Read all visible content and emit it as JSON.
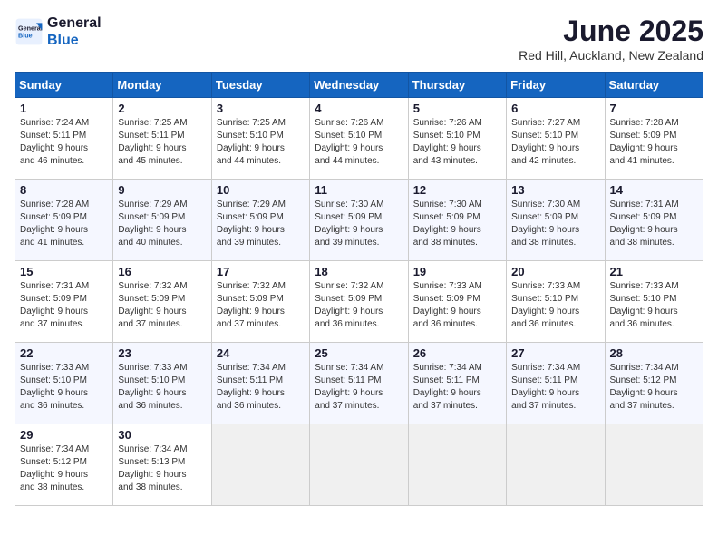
{
  "logo": {
    "line1": "General",
    "line2": "Blue"
  },
  "title": "June 2025",
  "subtitle": "Red Hill, Auckland, New Zealand",
  "weekdays": [
    "Sunday",
    "Monday",
    "Tuesday",
    "Wednesday",
    "Thursday",
    "Friday",
    "Saturday"
  ],
  "weeks": [
    [
      {
        "day": "1",
        "info": "Sunrise: 7:24 AM\nSunset: 5:11 PM\nDaylight: 9 hours\nand 46 minutes."
      },
      {
        "day": "2",
        "info": "Sunrise: 7:25 AM\nSunset: 5:11 PM\nDaylight: 9 hours\nand 45 minutes."
      },
      {
        "day": "3",
        "info": "Sunrise: 7:25 AM\nSunset: 5:10 PM\nDaylight: 9 hours\nand 44 minutes."
      },
      {
        "day": "4",
        "info": "Sunrise: 7:26 AM\nSunset: 5:10 PM\nDaylight: 9 hours\nand 44 minutes."
      },
      {
        "day": "5",
        "info": "Sunrise: 7:26 AM\nSunset: 5:10 PM\nDaylight: 9 hours\nand 43 minutes."
      },
      {
        "day": "6",
        "info": "Sunrise: 7:27 AM\nSunset: 5:10 PM\nDaylight: 9 hours\nand 42 minutes."
      },
      {
        "day": "7",
        "info": "Sunrise: 7:28 AM\nSunset: 5:09 PM\nDaylight: 9 hours\nand 41 minutes."
      }
    ],
    [
      {
        "day": "8",
        "info": "Sunrise: 7:28 AM\nSunset: 5:09 PM\nDaylight: 9 hours\nand 41 minutes."
      },
      {
        "day": "9",
        "info": "Sunrise: 7:29 AM\nSunset: 5:09 PM\nDaylight: 9 hours\nand 40 minutes."
      },
      {
        "day": "10",
        "info": "Sunrise: 7:29 AM\nSunset: 5:09 PM\nDaylight: 9 hours\nand 39 minutes."
      },
      {
        "day": "11",
        "info": "Sunrise: 7:30 AM\nSunset: 5:09 PM\nDaylight: 9 hours\nand 39 minutes."
      },
      {
        "day": "12",
        "info": "Sunrise: 7:30 AM\nSunset: 5:09 PM\nDaylight: 9 hours\nand 38 minutes."
      },
      {
        "day": "13",
        "info": "Sunrise: 7:30 AM\nSunset: 5:09 PM\nDaylight: 9 hours\nand 38 minutes."
      },
      {
        "day": "14",
        "info": "Sunrise: 7:31 AM\nSunset: 5:09 PM\nDaylight: 9 hours\nand 38 minutes."
      }
    ],
    [
      {
        "day": "15",
        "info": "Sunrise: 7:31 AM\nSunset: 5:09 PM\nDaylight: 9 hours\nand 37 minutes."
      },
      {
        "day": "16",
        "info": "Sunrise: 7:32 AM\nSunset: 5:09 PM\nDaylight: 9 hours\nand 37 minutes."
      },
      {
        "day": "17",
        "info": "Sunrise: 7:32 AM\nSunset: 5:09 PM\nDaylight: 9 hours\nand 37 minutes."
      },
      {
        "day": "18",
        "info": "Sunrise: 7:32 AM\nSunset: 5:09 PM\nDaylight: 9 hours\nand 36 minutes."
      },
      {
        "day": "19",
        "info": "Sunrise: 7:33 AM\nSunset: 5:09 PM\nDaylight: 9 hours\nand 36 minutes."
      },
      {
        "day": "20",
        "info": "Sunrise: 7:33 AM\nSunset: 5:10 PM\nDaylight: 9 hours\nand 36 minutes."
      },
      {
        "day": "21",
        "info": "Sunrise: 7:33 AM\nSunset: 5:10 PM\nDaylight: 9 hours\nand 36 minutes."
      }
    ],
    [
      {
        "day": "22",
        "info": "Sunrise: 7:33 AM\nSunset: 5:10 PM\nDaylight: 9 hours\nand 36 minutes."
      },
      {
        "day": "23",
        "info": "Sunrise: 7:33 AM\nSunset: 5:10 PM\nDaylight: 9 hours\nand 36 minutes."
      },
      {
        "day": "24",
        "info": "Sunrise: 7:34 AM\nSunset: 5:11 PM\nDaylight: 9 hours\nand 36 minutes."
      },
      {
        "day": "25",
        "info": "Sunrise: 7:34 AM\nSunset: 5:11 PM\nDaylight: 9 hours\nand 37 minutes."
      },
      {
        "day": "26",
        "info": "Sunrise: 7:34 AM\nSunset: 5:11 PM\nDaylight: 9 hours\nand 37 minutes."
      },
      {
        "day": "27",
        "info": "Sunrise: 7:34 AM\nSunset: 5:11 PM\nDaylight: 9 hours\nand 37 minutes."
      },
      {
        "day": "28",
        "info": "Sunrise: 7:34 AM\nSunset: 5:12 PM\nDaylight: 9 hours\nand 37 minutes."
      }
    ],
    [
      {
        "day": "29",
        "info": "Sunrise: 7:34 AM\nSunset: 5:12 PM\nDaylight: 9 hours\nand 38 minutes."
      },
      {
        "day": "30",
        "info": "Sunrise: 7:34 AM\nSunset: 5:13 PM\nDaylight: 9 hours\nand 38 minutes."
      },
      {
        "day": "",
        "info": ""
      },
      {
        "day": "",
        "info": ""
      },
      {
        "day": "",
        "info": ""
      },
      {
        "day": "",
        "info": ""
      },
      {
        "day": "",
        "info": ""
      }
    ]
  ]
}
